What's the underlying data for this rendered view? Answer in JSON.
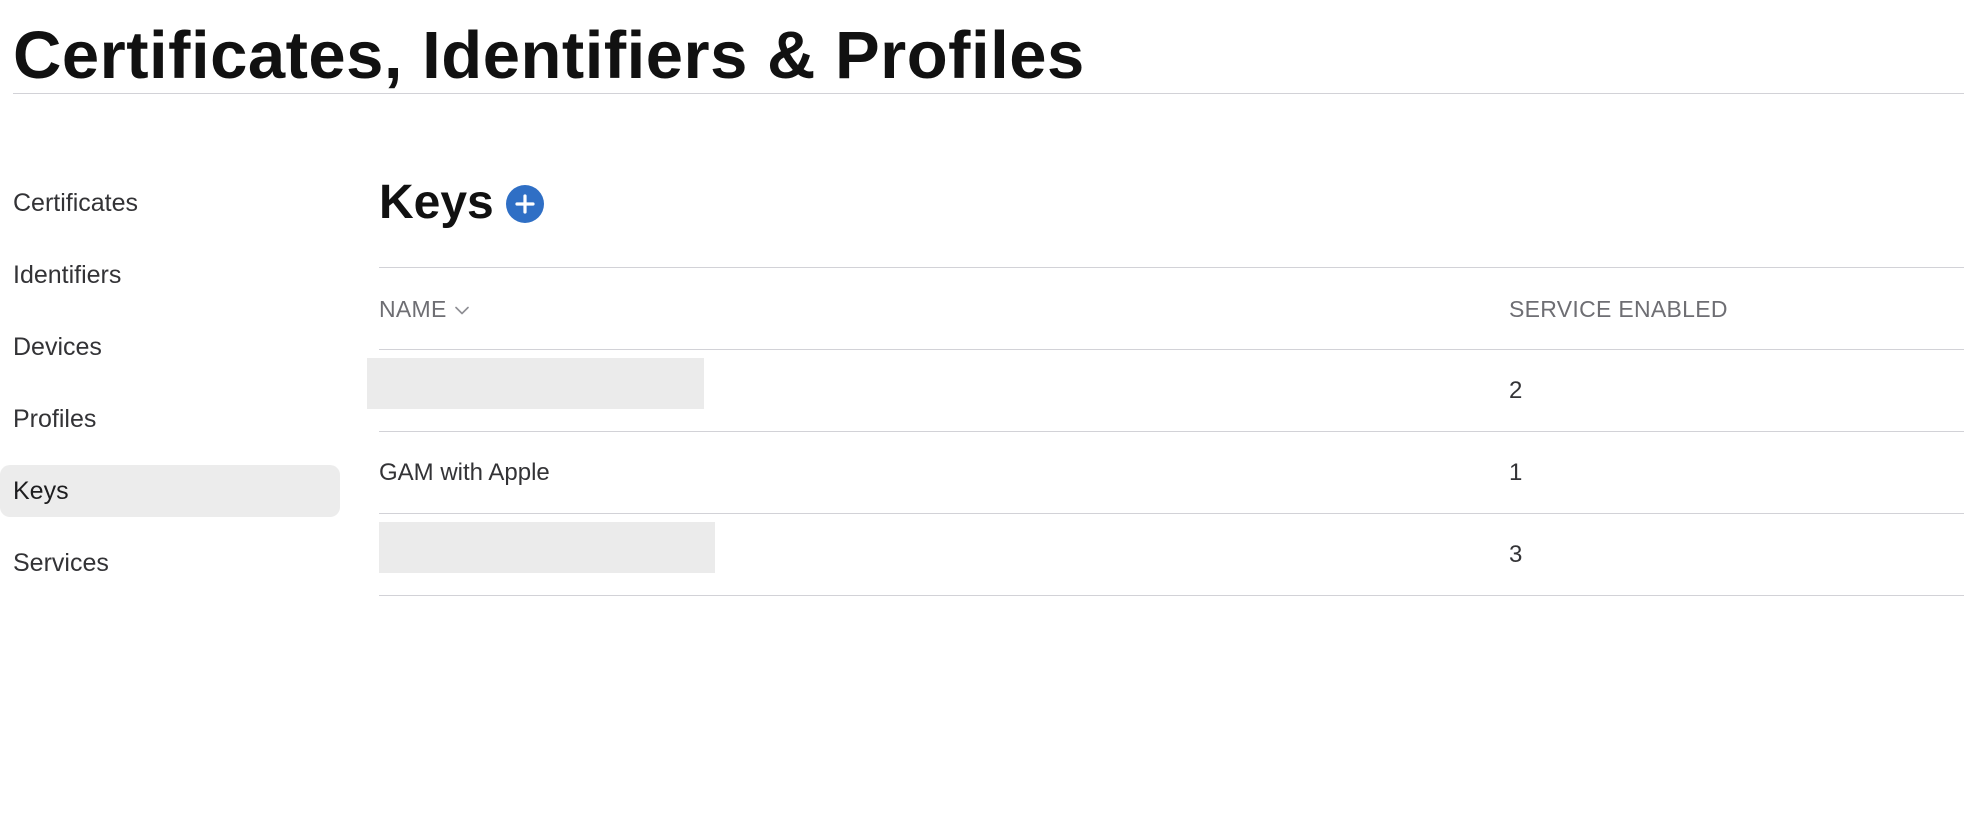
{
  "header": {
    "title": "Certificates, Identifiers & Profiles"
  },
  "sidebar": {
    "items": [
      {
        "label": "Certificates"
      },
      {
        "label": "Identifiers"
      },
      {
        "label": "Devices"
      },
      {
        "label": "Profiles"
      },
      {
        "label": "Keys",
        "selected": true
      },
      {
        "label": "Services"
      }
    ]
  },
  "main": {
    "section_title": "Keys",
    "add_icon": "plus-circle-icon",
    "accent_color": "#2f6fc5",
    "table": {
      "columns": {
        "name": "NAME",
        "service_enabled": "SERVICE ENABLED"
      },
      "sort_icon": "chevron-down-icon",
      "rows": [
        {
          "name": "",
          "name_redacted": true,
          "service_enabled": "2"
        },
        {
          "name": "GAM with Apple",
          "name_redacted": false,
          "service_enabled": "1"
        },
        {
          "name": "",
          "name_redacted": true,
          "service_enabled": "3"
        }
      ]
    }
  }
}
